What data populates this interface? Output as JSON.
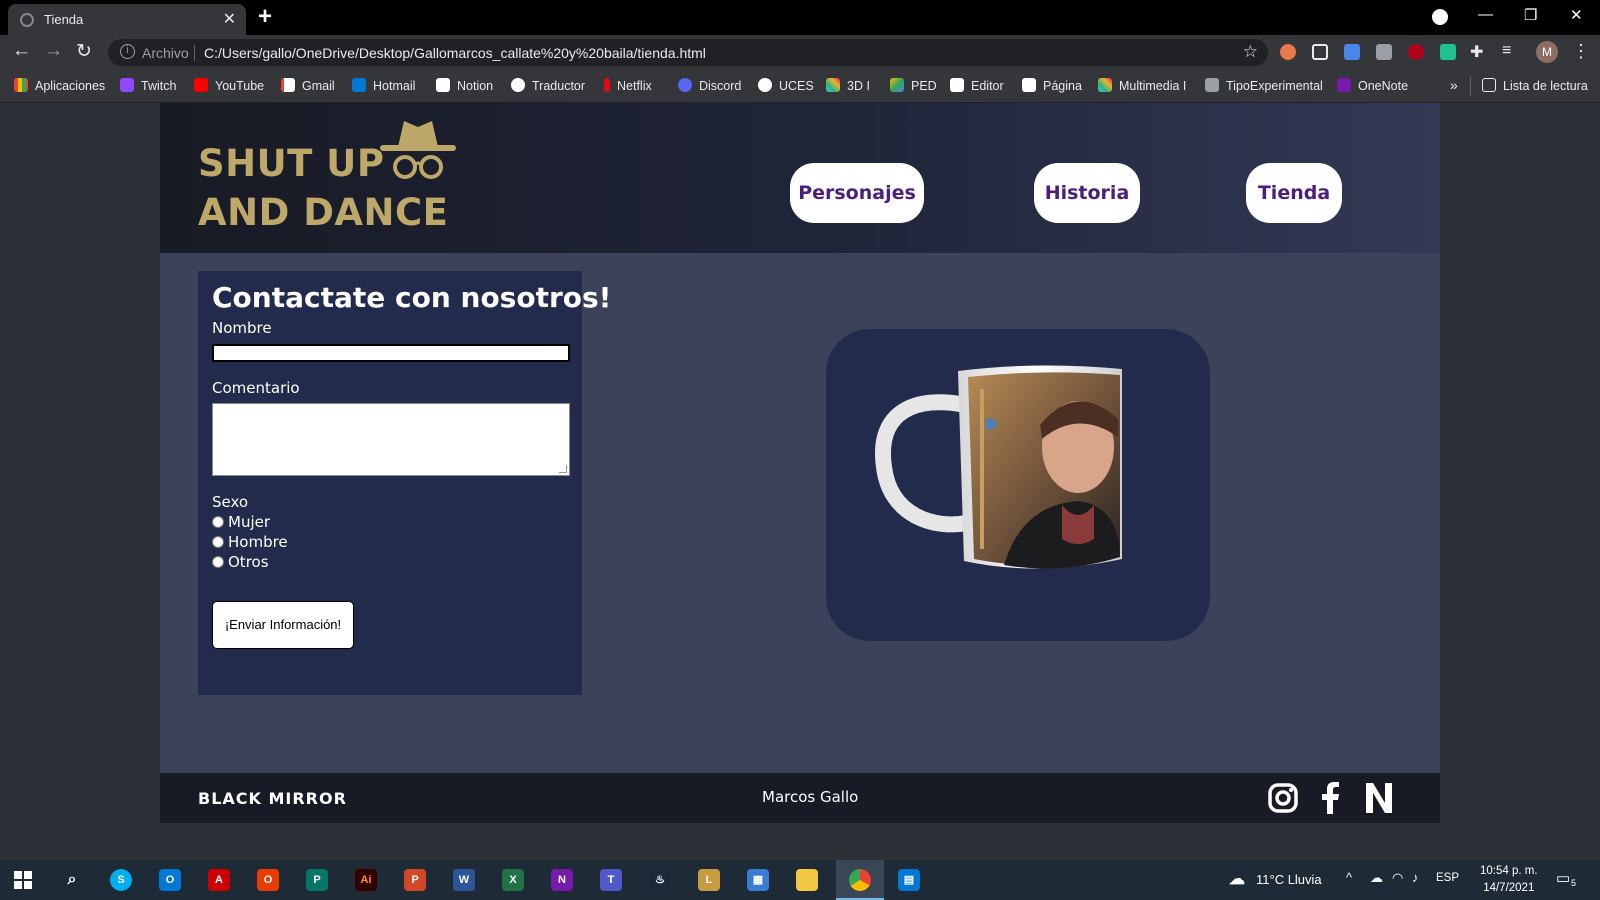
{
  "browser": {
    "tab_title": "Tienda",
    "address_label": "Archivo",
    "url": "C:/Users/gallo/OneDrive/Desktop/Gallomarcos_callate%20y%20baila/tienda.html",
    "profile_initial": "M",
    "bookmarks": [
      "Aplicaciones",
      "Twitch",
      "YouTube",
      "Gmail",
      "Hotmail",
      "Notion",
      "Traductor",
      "Netflix",
      "Discord",
      "UCES",
      "3D I",
      "PED",
      "Editor",
      "Página",
      "Multimedia I",
      "TipoExperimental",
      "OneNote"
    ],
    "more_bookmarks": "»",
    "reading_list": "Lista de lectura"
  },
  "site": {
    "logo_line1": "SHUT UP",
    "logo_line2": "AND DANCE",
    "nav": [
      "Personajes",
      "Historia",
      "Tienda"
    ],
    "form": {
      "title": "Contactate con nosotros!",
      "name_label": "Nombre",
      "name_value": "",
      "comment_label": "Comentario",
      "comment_value": "",
      "gender_label": "Sexo",
      "gender_options": [
        "Mujer",
        "Hombre",
        "Otros"
      ],
      "submit_label": "¡Enviar Información!"
    },
    "footer": {
      "brand": "BLACK MIRROR",
      "credit": "Marcos Gallo",
      "social": [
        "instagram-icon",
        "facebook-icon",
        "netflix-icon"
      ]
    }
  },
  "taskbar": {
    "weather": "11°C  Lluvia",
    "language": "ESP",
    "time": "10:54 p. m.",
    "date": "14/7/2021",
    "notifications": "5"
  },
  "colors": {
    "gold": "#bda769",
    "nav_text": "#4c1d7e",
    "card": "#222b4c",
    "page": "#3c4259"
  }
}
